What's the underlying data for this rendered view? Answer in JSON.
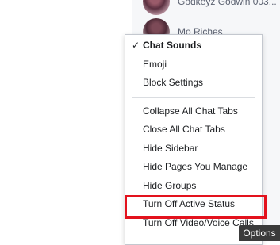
{
  "contacts": [
    {
      "name": "Godkeyz Godwin 003..."
    },
    {
      "name": "Mo Riches"
    }
  ],
  "menu": {
    "items": [
      {
        "label": "Chat Sounds",
        "checked_mark": "✓"
      },
      {
        "label": "Emoji"
      },
      {
        "label": "Block Settings"
      },
      {
        "label": "Collapse All Chat Tabs"
      },
      {
        "label": "Close All Chat Tabs"
      },
      {
        "label": "Hide Sidebar"
      },
      {
        "label": "Hide Pages You Manage"
      },
      {
        "label": "Hide Groups"
      },
      {
        "label": "Turn Off Active Status"
      },
      {
        "label": "Turn Off Video/Voice Calls"
      }
    ]
  },
  "tooltip": {
    "text": "Options"
  },
  "colors": {
    "highlight": "#e3121d",
    "tooltip_bg": "#3b3b3b"
  }
}
